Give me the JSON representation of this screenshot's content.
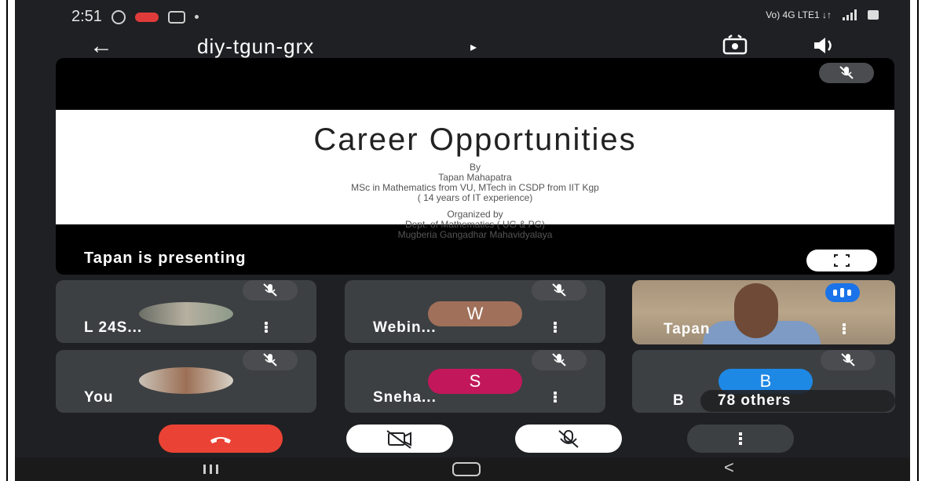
{
  "status_bar": {
    "time": "2:51",
    "network": "Vo) 4G LTE1 ↓↑"
  },
  "app_bar": {
    "meeting_code": "diy-tgun-grx",
    "caret": "▸"
  },
  "presentation": {
    "slide": {
      "title": "Career Opportunities",
      "lines": [
        "By",
        "Tapan Mahapatra",
        "MSc in Mathematics from VU, MTech in CSDP from IIT Kgp",
        "( 14 years of IT experience)",
        "Organized by",
        "Dept. of Mathematics ( UG & PG)",
        "Mugberia Gangadhar Mahavidyalaya"
      ]
    },
    "presenting_label": "Tapan is presenting"
  },
  "participants": [
    {
      "name": "L 24S...",
      "avatar_type": "photo"
    },
    {
      "name": "Webin...",
      "avatar_letter": "W",
      "avatar_color": "#a1705a"
    },
    {
      "name": "Tapan",
      "avatar_type": "video"
    },
    {
      "name": "You",
      "avatar_type": "photo"
    },
    {
      "name": "Sneha...",
      "avatar_letter": "S",
      "avatar_color": "#c2185b"
    },
    {
      "name": "B",
      "avatar_letter": "B",
      "avatar_color": "#1e88e5"
    }
  ],
  "others_label": "78 others",
  "colors": {
    "end_call": "#ea4335",
    "speaking": "#1a73e8",
    "tile_bg": "#3c4043"
  },
  "icons": [
    "back-arrow-icon",
    "switch-camera-icon",
    "speaker-icon",
    "mic-off-icon",
    "fullscreen-icon",
    "more-vert-icon",
    "end-call-icon",
    "camera-off-icon",
    "more-options-icon"
  ]
}
